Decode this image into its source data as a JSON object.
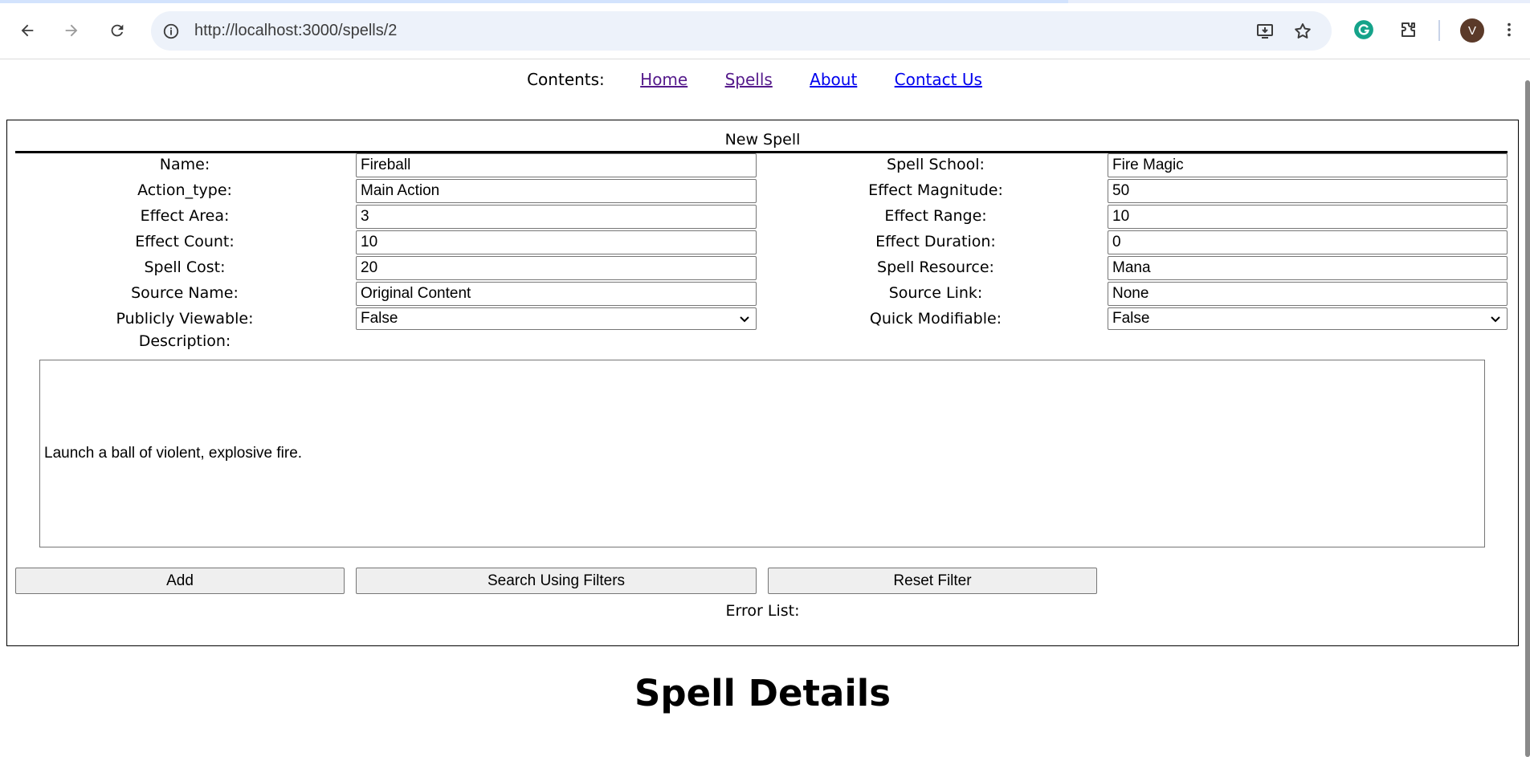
{
  "browser": {
    "url": "http://localhost:3000/spells/2",
    "avatar_initial": "V"
  },
  "nav": {
    "label": "Contents:",
    "links": [
      {
        "text": "Home",
        "visited": true
      },
      {
        "text": "Spells",
        "visited": true
      },
      {
        "text": "About",
        "visited": false
      },
      {
        "text": "Contact Us",
        "visited": false
      }
    ]
  },
  "form": {
    "title": "New Spell",
    "left": [
      {
        "label": "Name:",
        "value": "Fireball"
      },
      {
        "label": "Action_type:",
        "value": "Main Action"
      },
      {
        "label": "Effect Area:",
        "value": "3"
      },
      {
        "label": "Effect Count:",
        "value": "10"
      },
      {
        "label": "Spell Cost:",
        "value": "20"
      },
      {
        "label": "Source Name:",
        "value": "Original Content"
      },
      {
        "label": "Publicly Viewable:",
        "value": "False"
      }
    ],
    "right": [
      {
        "label": "Spell School:",
        "value": "Fire Magic"
      },
      {
        "label": "Effect Magnitude:",
        "value": "50"
      },
      {
        "label": "Effect Range:",
        "value": "10"
      },
      {
        "label": "Effect Duration:",
        "value": "0"
      },
      {
        "label": "Spell Resource:",
        "value": "Mana"
      },
      {
        "label": "Source Link:",
        "value": "None"
      },
      {
        "label": "Quick Modifiable:",
        "value": "False"
      }
    ],
    "description_label": "Description:",
    "description_value": "Launch a ball of violent, explosive fire.",
    "buttons": {
      "add": "Add",
      "search": "Search Using Filters",
      "reset": "Reset Filter"
    },
    "error_list_label": "Error List:"
  },
  "details": {
    "title": "Spell Details"
  }
}
